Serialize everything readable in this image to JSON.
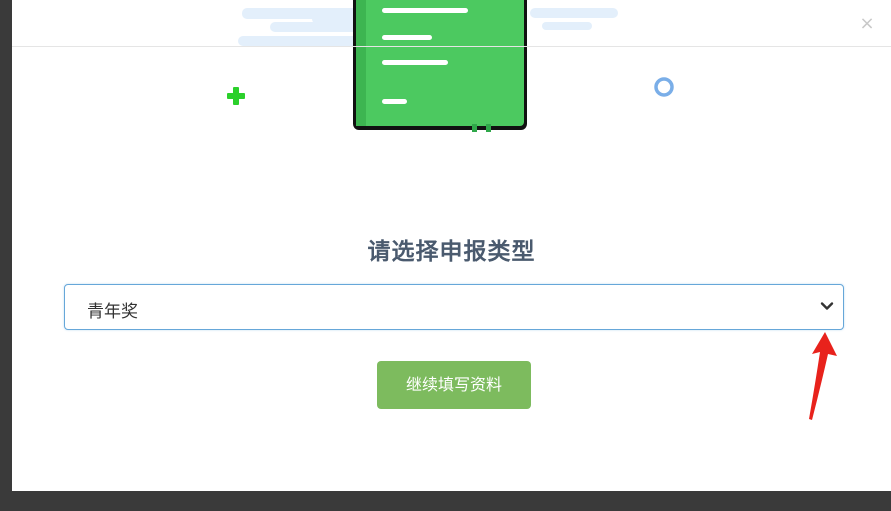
{
  "dialog": {
    "close_symbol": "×",
    "title": "请选择申报类型",
    "select": {
      "selected_value": "青年奖",
      "chevron_icon": "chevron-down-icon"
    },
    "continue_button": "继续填写资料"
  },
  "icons": {
    "close": "close-icon",
    "plus": "plus-icon",
    "circle": "circle-icon",
    "document": "document-icon",
    "annotation": "red-arrow-annotation"
  },
  "colors": {
    "accent_green": "#7dbb5e",
    "doc_green": "#4cc960",
    "plus_green": "#2bd02b",
    "circle_blue": "#7aaee8",
    "focus_border": "#66a7d9",
    "title_color": "#4a5a6e",
    "arrow_red": "#e8221c"
  }
}
